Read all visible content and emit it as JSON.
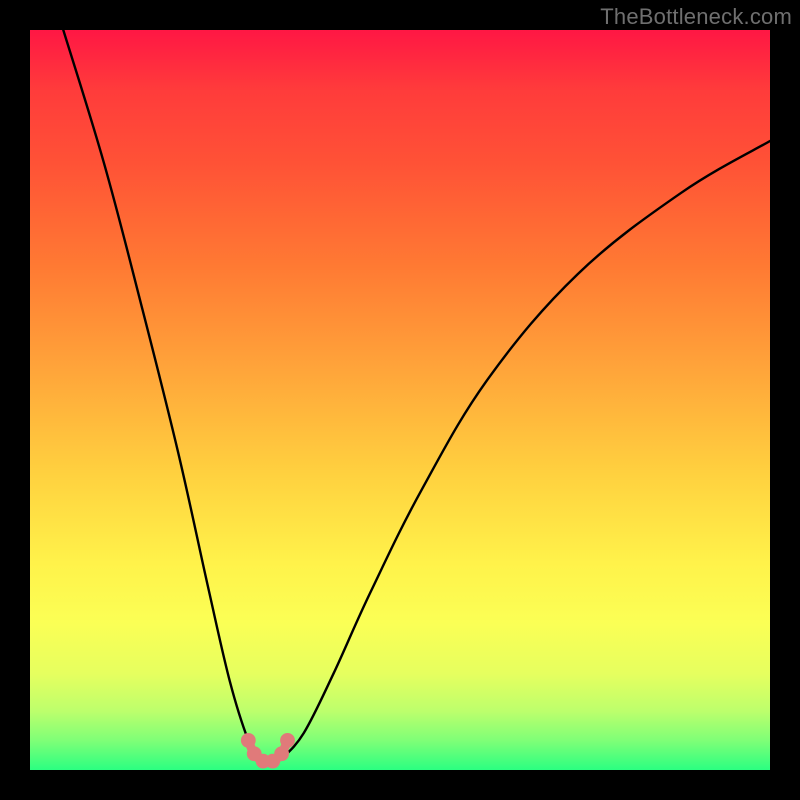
{
  "watermark": "TheBottleneck.com",
  "colors": {
    "frame": "#000000",
    "gradient_top": "#ff1744",
    "gradient_bottom": "#2bff81",
    "curve_stroke": "#000000",
    "bead_fill": "#e07a7a"
  },
  "chart_data": {
    "type": "line",
    "title": "",
    "xlabel": "",
    "ylabel": "",
    "xlim": [
      0,
      1
    ],
    "ylim": [
      0,
      1
    ],
    "notes": "Two black curves descend from opposite upper corners into a narrow V/U shaped minimum left of center; small salmon-colored beads trace the U at the bottom. Background is a vertical green-to-red gradient inside a black frame.",
    "series": [
      {
        "name": "left-curve",
        "x": [
          0.045,
          0.1,
          0.15,
          0.2,
          0.24,
          0.27,
          0.295,
          0.31
        ],
        "y": [
          1.0,
          0.82,
          0.63,
          0.43,
          0.25,
          0.12,
          0.04,
          0.015
        ]
      },
      {
        "name": "right-curve",
        "x": [
          0.34,
          0.37,
          0.41,
          0.46,
          0.53,
          0.62,
          0.74,
          0.88,
          1.0
        ],
        "y": [
          0.015,
          0.05,
          0.13,
          0.24,
          0.38,
          0.53,
          0.67,
          0.78,
          0.85
        ]
      }
    ],
    "beads": {
      "name": "u-minimum-beads",
      "points_xy": [
        [
          0.295,
          0.04
        ],
        [
          0.303,
          0.022
        ],
        [
          0.315,
          0.012
        ],
        [
          0.328,
          0.012
        ],
        [
          0.34,
          0.022
        ],
        [
          0.348,
          0.04
        ]
      ],
      "radius_fraction": 0.01
    }
  }
}
